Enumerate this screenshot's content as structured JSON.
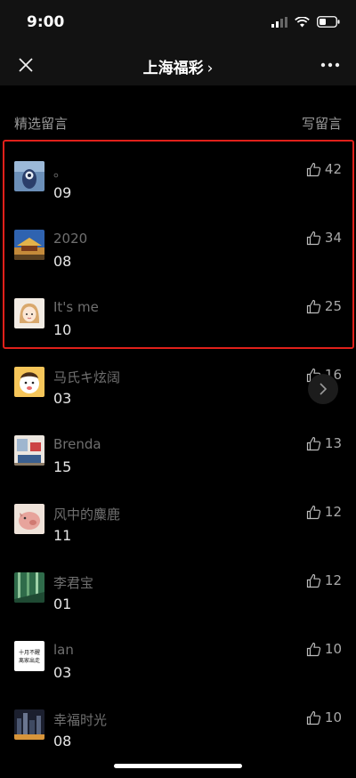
{
  "status_bar": {
    "time": "9:00"
  },
  "nav": {
    "title": "上海福彩",
    "title_chevron": "›",
    "close_icon": "close-icon",
    "more_icon": "more-icon"
  },
  "section": {
    "title": "精选留言",
    "write_label": "写留言"
  },
  "colors": {
    "background": "#000000",
    "highlight": "#e0201a",
    "name_text": "#6f6f6f",
    "comment_text": "#e6e6e6"
  },
  "comments": [
    {
      "name": "。",
      "text": "09",
      "likes": "42",
      "avatar": "avatar-blue-statue"
    },
    {
      "name": "2020",
      "text": "08",
      "likes": "34",
      "avatar": "avatar-temple"
    },
    {
      "name": "It's me",
      "text": "10",
      "likes": "25",
      "avatar": "avatar-cartoon-girl"
    },
    {
      "name": "马氏キ炫阔",
      "text": "03",
      "likes": "16",
      "avatar": "avatar-cartoon-baby"
    },
    {
      "name": "Brenda",
      "text": "15",
      "likes": "13",
      "avatar": "avatar-room"
    },
    {
      "name": "风中的麋鹿",
      "text": "11",
      "likes": "12",
      "avatar": "avatar-pig"
    },
    {
      "name": "李君宝",
      "text": "01",
      "likes": "12",
      "avatar": "avatar-bamboo"
    },
    {
      "name": "lan",
      "text": "03",
      "likes": "10",
      "avatar": "avatar-text-card",
      "avatar_text": [
        "十月不醒",
        "离家出走"
      ]
    },
    {
      "name": "幸福时光",
      "text": "08",
      "likes": "10",
      "avatar": "avatar-city"
    }
  ]
}
